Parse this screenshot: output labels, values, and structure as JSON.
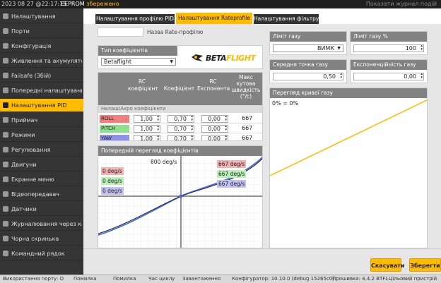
{
  "topbar": {
    "datetime": "2023 08 27 @22:17:15",
    "eeprom": "EEPROM",
    "eeprom_saved": "збережено",
    "show_log": "Показати журнал подій"
  },
  "sidebar": {
    "items": [
      {
        "label": "Налаштування",
        "icon": "wrench-icon"
      },
      {
        "label": "Порти",
        "icon": "plug-icon"
      },
      {
        "label": "Конфігурація",
        "icon": "gear-icon"
      },
      {
        "label": "Живлення та акумулятор",
        "icon": "battery-icon"
      },
      {
        "label": "Failsafe (Збій)",
        "icon": "shield-icon"
      },
      {
        "label": "Попередні налаштування",
        "icon": "presets-icon"
      },
      {
        "label": "Налаштування PID",
        "icon": "sliders-icon"
      },
      {
        "label": "Приймач",
        "icon": "receiver-icon"
      },
      {
        "label": "Режими",
        "icon": "toggle-icon"
      },
      {
        "label": "Регулювання",
        "icon": "adjust-icon"
      },
      {
        "label": "Двигуни",
        "icon": "motor-icon"
      },
      {
        "label": "Екранне меню",
        "icon": "osd-icon"
      },
      {
        "label": "Відеопередавач",
        "icon": "vtx-icon"
      },
      {
        "label": "Датчики",
        "icon": "sensor-icon"
      },
      {
        "label": "Журналювання через каб...",
        "icon": "log-icon"
      },
      {
        "label": "Чорна скринька",
        "icon": "blackbox-icon"
      },
      {
        "label": "Командний рядок",
        "icon": "cli-icon"
      }
    ],
    "active_index": 6
  },
  "tabs": [
    {
      "label": "Налаштування профілю PID"
    },
    {
      "label": "Налаштування Rateprofile"
    },
    {
      "label": "Налаштування фільтру"
    }
  ],
  "rate": {
    "name_placeholder": "",
    "name_label": "Назва Rate-профілю",
    "type_header": "Тип коефіцієнтів",
    "type_value": "Betaflight",
    "logo_part1": "BETA",
    "logo_part2": "FLIGHT",
    "cols": [
      "RC коефіцієнт",
      "Коефіцієнт",
      "RC Експонента",
      "Макс кутова швидкість (°/с)"
    ],
    "section": "Налаш/Акро коефіцієнти",
    "rows": [
      {
        "axis": "ROLL",
        "rc": "1,00",
        "rate": "0,70",
        "expo": "0,00",
        "max": "667",
        "color": "#f08080"
      },
      {
        "axis": "PITCH",
        "rc": "1,00",
        "rate": "0,70",
        "expo": "0,00",
        "max": "667",
        "color": "#8fe08f"
      },
      {
        "axis": "YAW",
        "rc": "1,00",
        "rate": "0,70",
        "expo": "0,00",
        "max": "667",
        "color": "#8f8ff0"
      }
    ],
    "preview_header": "Попередній перегляд коефіцієнтів",
    "center_label": "800 deg/s",
    "left_labels": [
      "0 deg/s",
      "0 deg/s",
      "0 deg/s"
    ],
    "right_labels": [
      "667 deg/s",
      "667 deg/s",
      "667 deg/s"
    ]
  },
  "throttle": {
    "limit_header": "Ліміт газу",
    "limit_pct_header": "Ліміт газу %",
    "limit_type": "ВИМК",
    "limit_pct": "100",
    "mid_header": "Середня точка газу",
    "expo_header": "Експоненційність газу",
    "mid": "0,50",
    "expo": "0,00",
    "curve_header": "Перегляд кривої газу",
    "curve_label": "0% = 0%"
  },
  "buttons": {
    "cancel": "Скасувати",
    "save": "Зберегти"
  },
  "status": {
    "port_usage": "Використання порту: D",
    "packet_error": "Помилка",
    "i2c_error": "Помилка",
    "cycle_time": "Час циклу",
    "cpu_load": "Завантаження",
    "configurator": "Конфігуратор: 10.10.0 (debug 15265c0)",
    "firmware": "Прошивка: 4.4.2 BTFL",
    "target": "Цільовий пристрій"
  },
  "colors": {
    "accent": "#ffbb00",
    "roll": "#f08080",
    "pitch": "#8fe08f",
    "yaw": "#8f8ff0"
  }
}
